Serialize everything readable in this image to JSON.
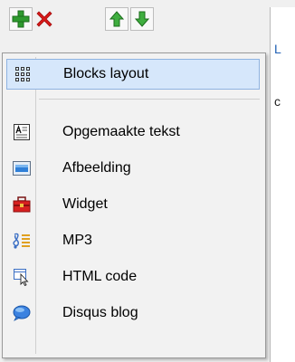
{
  "toolbar": {
    "buttons": [
      {
        "icon": "plus-icon",
        "color": "#2e9a2e"
      },
      {
        "icon": "delete-x-icon",
        "color": "#d81818"
      },
      {
        "icon": "arrow-up-icon",
        "color": "#2e9a2e"
      },
      {
        "icon": "arrow-down-icon",
        "color": "#2e9a2e"
      }
    ]
  },
  "content": {
    "line1": "L",
    "line2": "c"
  },
  "menu": {
    "items": [
      {
        "label": "Blocks layout",
        "icon": "blocks-grid-icon",
        "selected": true
      },
      {
        "label": "Opgemaakte tekst",
        "icon": "formatted-text-icon"
      },
      {
        "label": "Afbeelding",
        "icon": "image-icon"
      },
      {
        "label": "Widget",
        "icon": "widget-toolbox-icon"
      },
      {
        "label": "MP3",
        "icon": "music-note-icon"
      },
      {
        "label": "HTML code",
        "icon": "html-cursor-icon"
      },
      {
        "label": "Disqus blog",
        "icon": "speech-bubble-icon"
      }
    ]
  }
}
